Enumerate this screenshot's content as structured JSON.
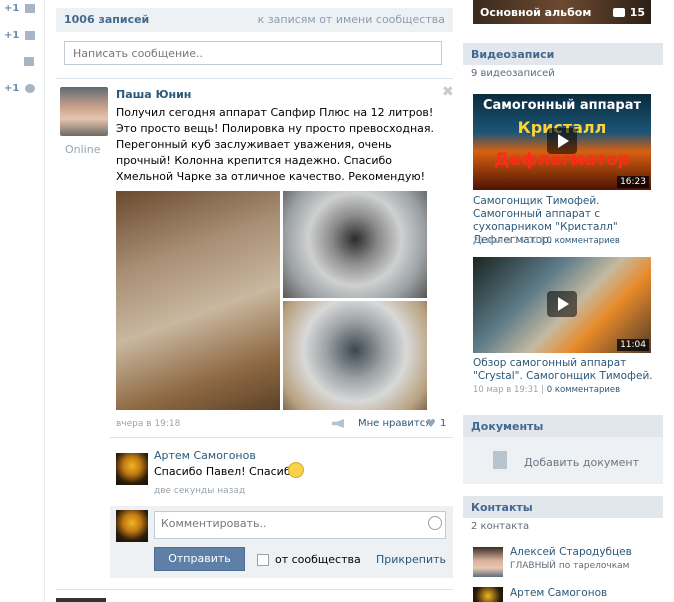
{
  "left_strip": {
    "items": [
      {
        "label": "+1",
        "icon": "envelope-icon"
      },
      {
        "label": "+1",
        "icon": "people-icon"
      },
      {
        "label": "",
        "icon": "speech-bubble-icon"
      },
      {
        "label": "+1",
        "icon": "gear-icon"
      }
    ]
  },
  "wall": {
    "count_label": "1006 записей",
    "community_link": "к записям от имени сообщества",
    "post_placeholder": "Написать сообщение.."
  },
  "post": {
    "author": "Паша Юнин",
    "status": "Online",
    "text": "Получил сегодня аппарат Сапфир Плюс на 12 литров! Это просто вещь! Полировка ну просто превосходная. Перегонный куб заслуживает уважения, очень прочный! Колонна крепится надежно. Спасибо Хмельной Чарке за отличное качество. Рекомендую!",
    "time": "вчера в 19:18",
    "like_label": "Мне нравится",
    "like_count": "1"
  },
  "comment": {
    "author": "Артем Самогонов",
    "text": "Спасибо Павел! Спасибо!",
    "time": "две секунды назад"
  },
  "reply": {
    "placeholder": "Комментировать..",
    "send_label": "Отправить",
    "from_community_label": "от сообщества",
    "attach_label": "Прикрепить"
  },
  "right": {
    "album": {
      "title": "Основной альбом",
      "count": "15"
    },
    "videos": {
      "title": "Видеозаписи",
      "count_label": "9 видеозаписей",
      "items": [
        {
          "thumb_lines": [
            "Самогонный аппарат",
            "Кристалл",
            "Дефлегматор"
          ],
          "duration": "16:23",
          "title": "Самогонщик Тимофей. Самогонный аппарат с сухопарником \"Кристалл\" Дефлегматор.",
          "date": "21 мая в 14:00",
          "comments": "0 комментариев"
        },
        {
          "duration": "11:04",
          "title": "Обзор самогонный аппарат \"Crystal\". Самогонщик Тимофей.",
          "date": "10 мар в 19:31",
          "comments": "0 комментариев"
        }
      ]
    },
    "documents": {
      "title": "Документы",
      "add_label": "Добавить документ"
    },
    "contacts": {
      "title": "Контакты",
      "count_label": "2 контакта",
      "items": [
        {
          "name": "Алексей Стародубцев",
          "role": "ГЛАВНЫЙ по тарелочкам"
        },
        {
          "name": "Артем Самогонов",
          "role": ""
        }
      ]
    }
  }
}
